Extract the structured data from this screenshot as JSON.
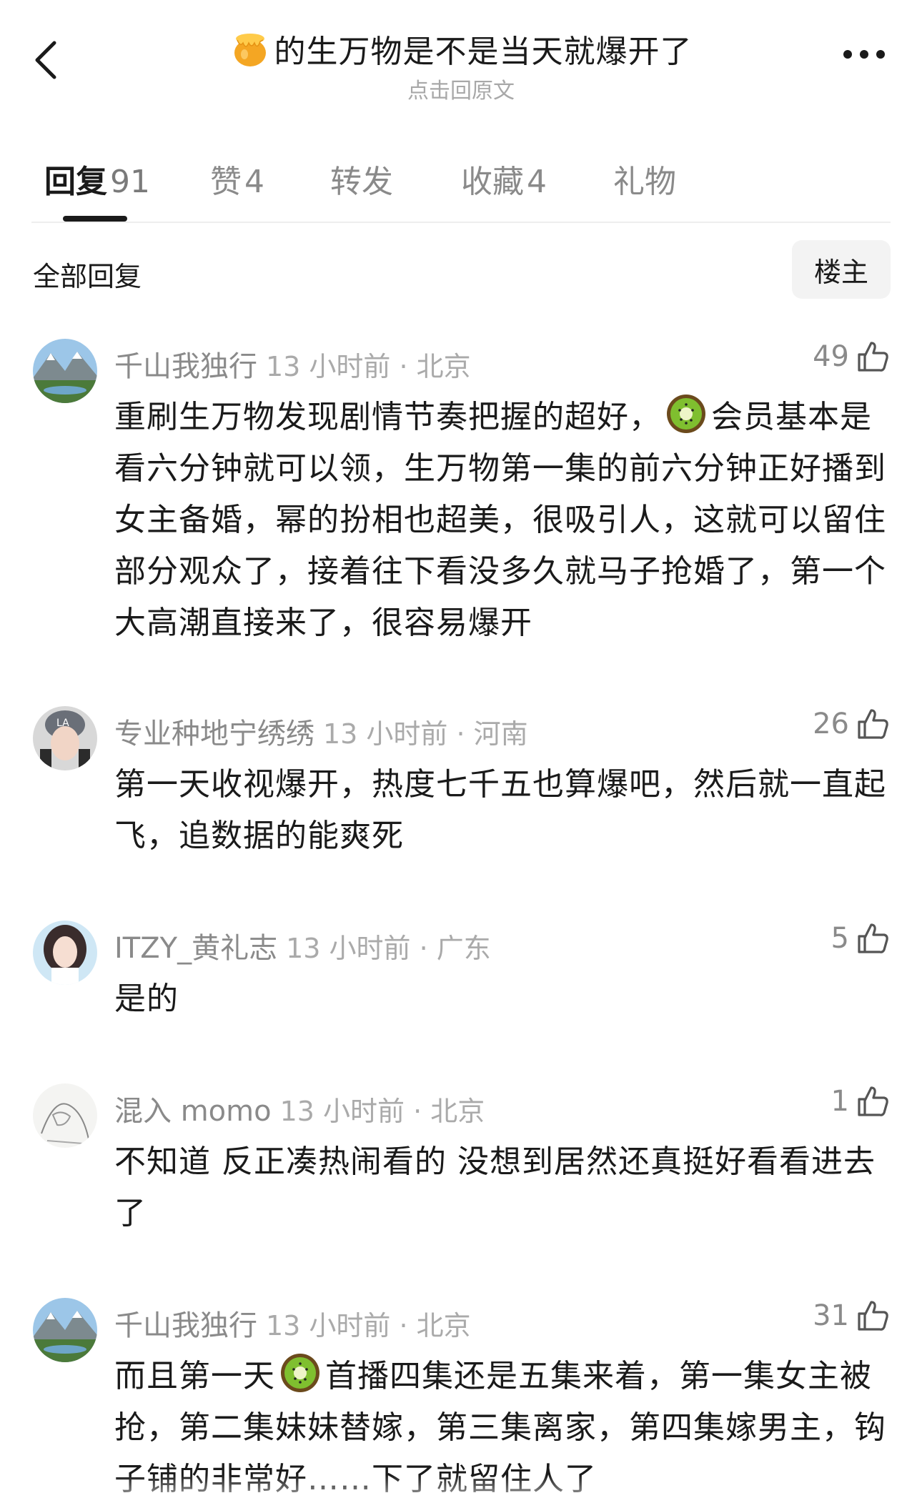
{
  "header": {
    "title": "的生万物是不是当天就爆开了",
    "subtitle": "点击回原文"
  },
  "tabs": [
    {
      "label": "回复",
      "count": "91"
    },
    {
      "label": "赞",
      "count": "4"
    },
    {
      "label": "转发",
      "count": ""
    },
    {
      "label": "收藏",
      "count": "4"
    },
    {
      "label": "礼物",
      "count": ""
    }
  ],
  "filter": {
    "all_label": "全部回复",
    "op_label": "楼主"
  },
  "comments": [
    {
      "user": "千山我独行",
      "time": "13 小时前 · 北京",
      "likes": "49",
      "text_a": "重刷生万物发现剧情节奏把握的超好，",
      "text_b": "会员基本是看六分钟就可以领，生万物第一集的前六分钟正好播到女主备婚，幂的扮相也超美，很吸引人，这就可以留住部分观众了，接着往下看没多久就马子抢婚了，第一个大高潮直接来了，很容易爆开"
    },
    {
      "user": "专业种地宁绣绣",
      "time": "13 小时前 · 河南",
      "likes": "26",
      "text": "第一天收视爆开，热度七千五也算爆吧，然后就一直起飞，追数据的能爽死"
    },
    {
      "user": "ITZY_黄礼志",
      "time": "13 小时前 · 广东",
      "likes": "5",
      "text": "是的"
    },
    {
      "user": "混入 momo",
      "time": "13 小时前 · 北京",
      "likes": "1",
      "text": "不知道 反正凑热闹看的 没想到居然还真挺好看看进去了"
    },
    {
      "user": "千山我独行",
      "time": "13 小时前 · 北京",
      "likes": "31",
      "text_a": "而且第一天",
      "text_b": "首播四集还是五集来着，第一集女主被抢，第二集妹妹替嫁，第三集离家，第四集嫁男主，钩子铺的非常好……下了就留住人了"
    }
  ]
}
